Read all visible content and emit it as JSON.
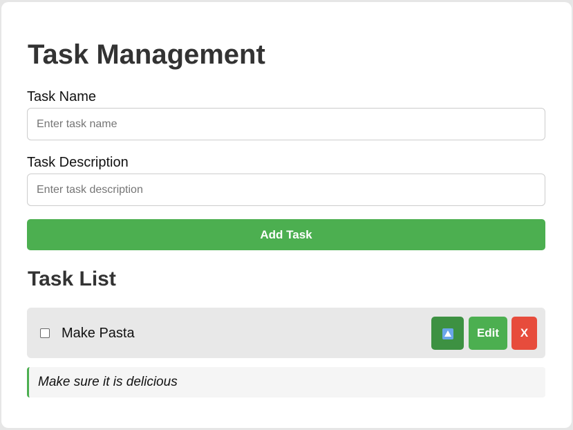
{
  "page": {
    "title": "Task Management"
  },
  "form": {
    "name_label": "Task Name",
    "name_placeholder": "Enter task name",
    "name_value": "",
    "description_label": "Task Description",
    "description_placeholder": "Enter task description",
    "description_value": "",
    "add_button_label": "Add Task"
  },
  "task_list": {
    "title": "Task List",
    "tasks": [
      {
        "name": "Make Pasta",
        "completed": false,
        "description": "Make sure it is delicious",
        "move_up_icon": "up-arrow-icon",
        "edit_label": "Edit",
        "delete_label": "X"
      }
    ]
  },
  "colors": {
    "primary_green": "#4caf50",
    "dark_green": "#3d9142",
    "danger_red": "#e74c3c",
    "row_background": "#e8e8e8"
  }
}
